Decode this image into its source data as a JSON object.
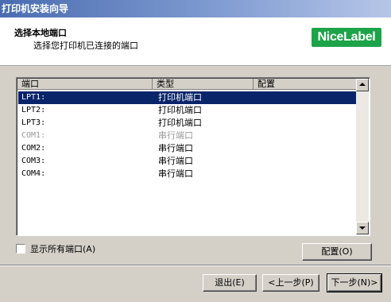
{
  "window": {
    "title": "打印机安装向导"
  },
  "header": {
    "title": "选择本地端口",
    "subtitle": "选择您打印机已连接的端口",
    "logo_text": "NiceLabel",
    "logo_color": "#1da34a"
  },
  "list": {
    "columns": [
      "端口",
      "类型",
      "配置"
    ],
    "rows": [
      {
        "port": "LPT1:",
        "type": "打印机端口",
        "selected": true,
        "disabled": false
      },
      {
        "port": "LPT2:",
        "type": "打印机端口",
        "selected": false,
        "disabled": false
      },
      {
        "port": "LPT3:",
        "type": "打印机端口",
        "selected": false,
        "disabled": false
      },
      {
        "port": "COM1:",
        "type": "串行端口",
        "selected": false,
        "disabled": true
      },
      {
        "port": "COM2:",
        "type": "串行端口",
        "selected": false,
        "disabled": false
      },
      {
        "port": "COM3:",
        "type": "串行端口",
        "selected": false,
        "disabled": false
      },
      {
        "port": "COM4:",
        "type": "串行端口",
        "selected": false,
        "disabled": false
      }
    ]
  },
  "options": {
    "show_all_ports_label": "显示所有端口(A)",
    "show_all_ports_checked": false
  },
  "buttons": {
    "configure": "配置(O)",
    "exit": "退出(E)",
    "back": "<上一步(P)",
    "next": "下一步(N)>"
  },
  "colors": {
    "selection": "#0a246a",
    "dialog_bg": "#d4d0c8"
  }
}
